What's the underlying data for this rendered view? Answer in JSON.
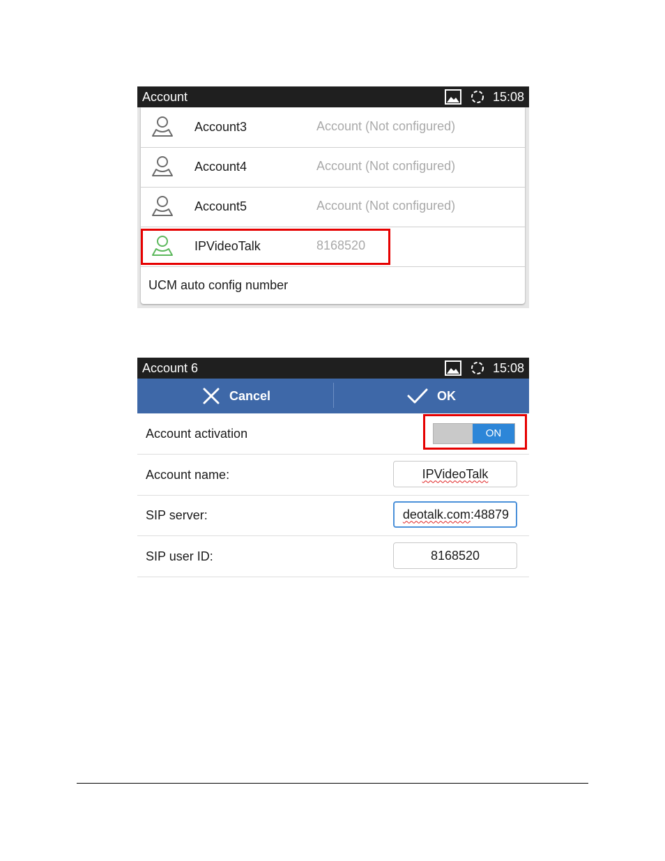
{
  "account_list": {
    "title": "Account",
    "clock": "15:08",
    "icons": {
      "status_image": "image-icon",
      "status_sync": "sync-icon",
      "avatar": "person-icon"
    },
    "rows": [
      {
        "name": "Account3",
        "status": "Account (Not configured)",
        "avatar_color": "#6b6b6b"
      },
      {
        "name": "Account4",
        "status": "Account (Not configured)",
        "avatar_color": "#6b6b6b"
      },
      {
        "name": "Account5",
        "status": "Account (Not configured)",
        "avatar_color": "#6b6b6b"
      },
      {
        "name": "IPVideoTalk",
        "status": "8168520",
        "avatar_color": "#5cb85c"
      }
    ],
    "extra_item": "UCM auto config number"
  },
  "account_edit": {
    "title": "Account 6",
    "clock": "15:08",
    "cancel_label": "Cancel",
    "ok_label": "OK",
    "activation_label": "Account activation",
    "activation_state": "ON",
    "account_name_label": "Account name:",
    "account_name_value": "IPVideoTalk",
    "sip_server_label": "SIP server:",
    "sip_server_value_underlined": "deotalk.com",
    "sip_server_value_rest": ":48879",
    "sip_user_id_label": "SIP user ID:",
    "sip_user_id_value": "8168520"
  },
  "colors": {
    "action_bar": "#3e68a8",
    "toggle_on": "#2d86d8",
    "highlight": "#e60000",
    "configured_avatar": "#5cb85c"
  }
}
